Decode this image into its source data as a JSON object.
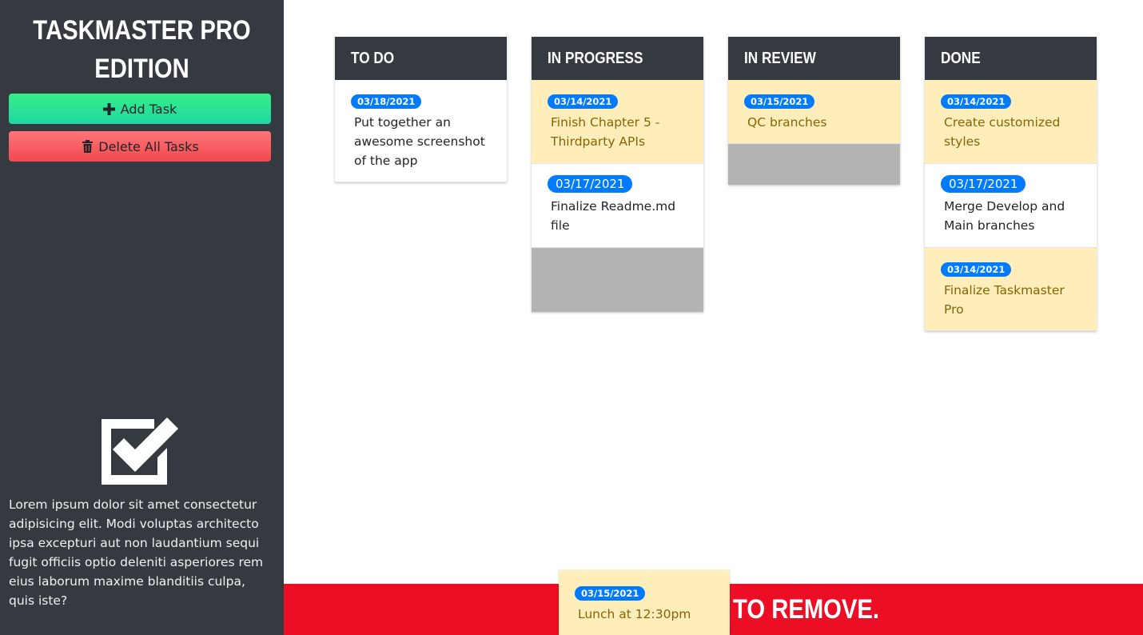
{
  "sidebar": {
    "title_line1": "TASKMASTER PRO",
    "title_line2": "EDITION",
    "add_task_label": "Add Task",
    "delete_all_label": "Delete All Tasks",
    "description": "Lorem ipsum dolor sit amet consectetur adipisicing elit. Modi voluptas architecto ipsa excepturi aut non laudantium sequi fugit officiis optio deleniti asperiores rem eius laborum maxime blanditiis culpa, quis iste?"
  },
  "columns": [
    {
      "title": "To Do",
      "cards": [
        {
          "date": "03/18/2021",
          "text": "Put together an awesome screenshot of the app",
          "style": "white"
        }
      ]
    },
    {
      "title": "In Progress",
      "cards": [
        {
          "date": "03/14/2021",
          "text": "Finish Chapter 5 - Thirdparty APIs",
          "style": "yellow"
        },
        {
          "date": "03/17/2021",
          "text": "Finalize Readme.md file",
          "style": "white"
        }
      ]
    },
    {
      "title": "In Review",
      "cards": [
        {
          "date": "03/15/2021",
          "text": "QC branches",
          "style": "yellow"
        }
      ]
    },
    {
      "title": "Done",
      "cards": [
        {
          "date": "03/14/2021",
          "text": "Create customized styles",
          "style": "yellow"
        },
        {
          "date": "03/17/2021",
          "text": "Merge Develop and Main branches",
          "style": "white"
        },
        {
          "date": "03/14/2021",
          "text": "Finalize Taskmaster Pro",
          "style": "yellow"
        }
      ]
    }
  ],
  "trash": {
    "label": "TO REMOVE."
  },
  "dragging_card": {
    "date": "03/15/2021",
    "text": "Lunch at 12:30pm"
  },
  "colors": {
    "sidebar_bg": "#343a40",
    "badge_blue": "#007bff",
    "warning_card": "#ffeeba",
    "trash_red": "#eb0e25"
  }
}
